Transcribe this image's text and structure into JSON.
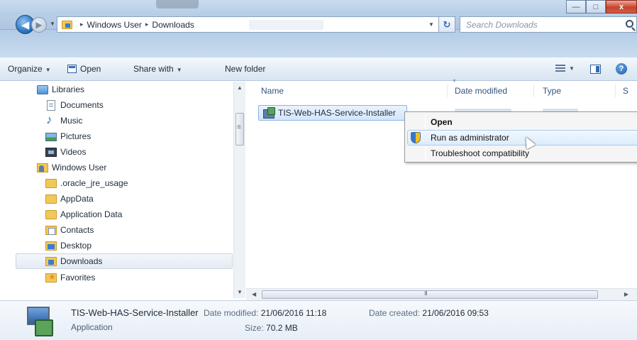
{
  "window": {
    "minimize_glyph": "—",
    "maximize_glyph": "□",
    "close_glyph": "x"
  },
  "address": {
    "path": [
      "Windows User",
      "Downloads"
    ],
    "separator": "▸",
    "search_placeholder": "Search Downloads"
  },
  "toolbar": {
    "organize": "Organize",
    "open": "Open",
    "share_with": "Share with",
    "new_folder": "New folder"
  },
  "nav": {
    "items": [
      {
        "label": "Libraries",
        "icon": "libraries-icon"
      },
      {
        "label": "Documents",
        "icon": "documents-icon"
      },
      {
        "label": "Music",
        "icon": "music-icon"
      },
      {
        "label": "Pictures",
        "icon": "pictures-icon"
      },
      {
        "label": "Videos",
        "icon": "videos-icon"
      },
      {
        "label": "Windows User",
        "icon": "user-folder-icon"
      },
      {
        "label": ".oracle_jre_usage",
        "icon": "folder-icon"
      },
      {
        "label": "AppData",
        "icon": "folder-icon"
      },
      {
        "label": "Application Data",
        "icon": "folder-icon"
      },
      {
        "label": "Contacts",
        "icon": "contacts-icon"
      },
      {
        "label": "Desktop",
        "icon": "desktop-icon"
      },
      {
        "label": "Downloads",
        "icon": "downloads-icon"
      },
      {
        "label": "Favorites",
        "icon": "favorites-icon"
      }
    ],
    "selected": "Downloads"
  },
  "columns": {
    "name": "Name",
    "date_modified": "Date modified",
    "type": "Type",
    "size_partial": "S"
  },
  "file": {
    "name": "TIS-Web-HAS-Service-Installer"
  },
  "context_menu": {
    "open": "Open",
    "run_as_admin": "Run as administrator",
    "troubleshoot": "Troubleshoot compatibility"
  },
  "details": {
    "name": "TIS-Web-HAS-Service-Installer",
    "type": "Application",
    "date_modified_label": "Date modified:",
    "date_modified": "21/06/2016 11:18",
    "size_label": "Size:",
    "size": "70.2 MB",
    "date_created_label": "Date created:",
    "date_created": "21/06/2016 09:53"
  }
}
